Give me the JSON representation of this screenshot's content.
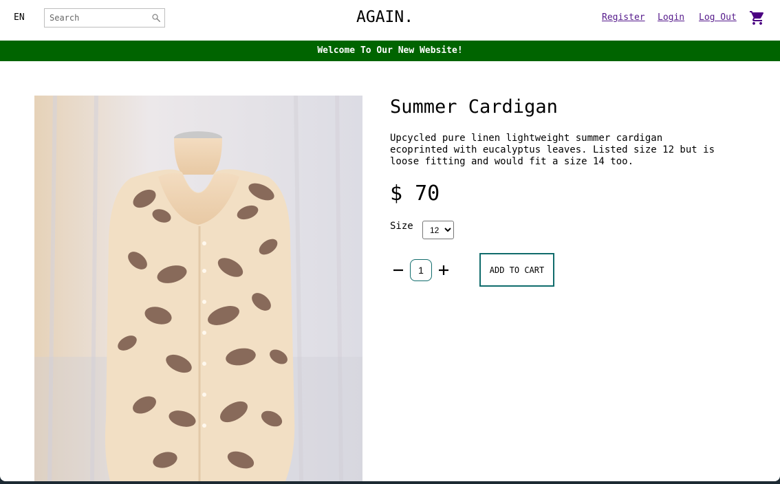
{
  "header": {
    "language": "EN",
    "search_placeholder": "Search",
    "logo": "AGAIN.",
    "nav": {
      "register": "Register",
      "login": "Login",
      "logout": "Log Out"
    }
  },
  "banner": {
    "text": "Welcome To Our New Website!",
    "color": "#006400"
  },
  "product": {
    "title": "Summer Cardigan",
    "description": "Upcycled pure linen lightweight summer cardigan ecoprinted with eucalyptus leaves. Listed size 12 but is loose fitting and would fit a size 14 too.",
    "price": "$ 70",
    "size_label": "Size",
    "size_selected": "12",
    "quantity": "1",
    "add_to_cart": "ADD TO CART"
  },
  "colors": {
    "accent": "#0f6b6b",
    "link": "#551a8b",
    "banner": "#006400"
  }
}
